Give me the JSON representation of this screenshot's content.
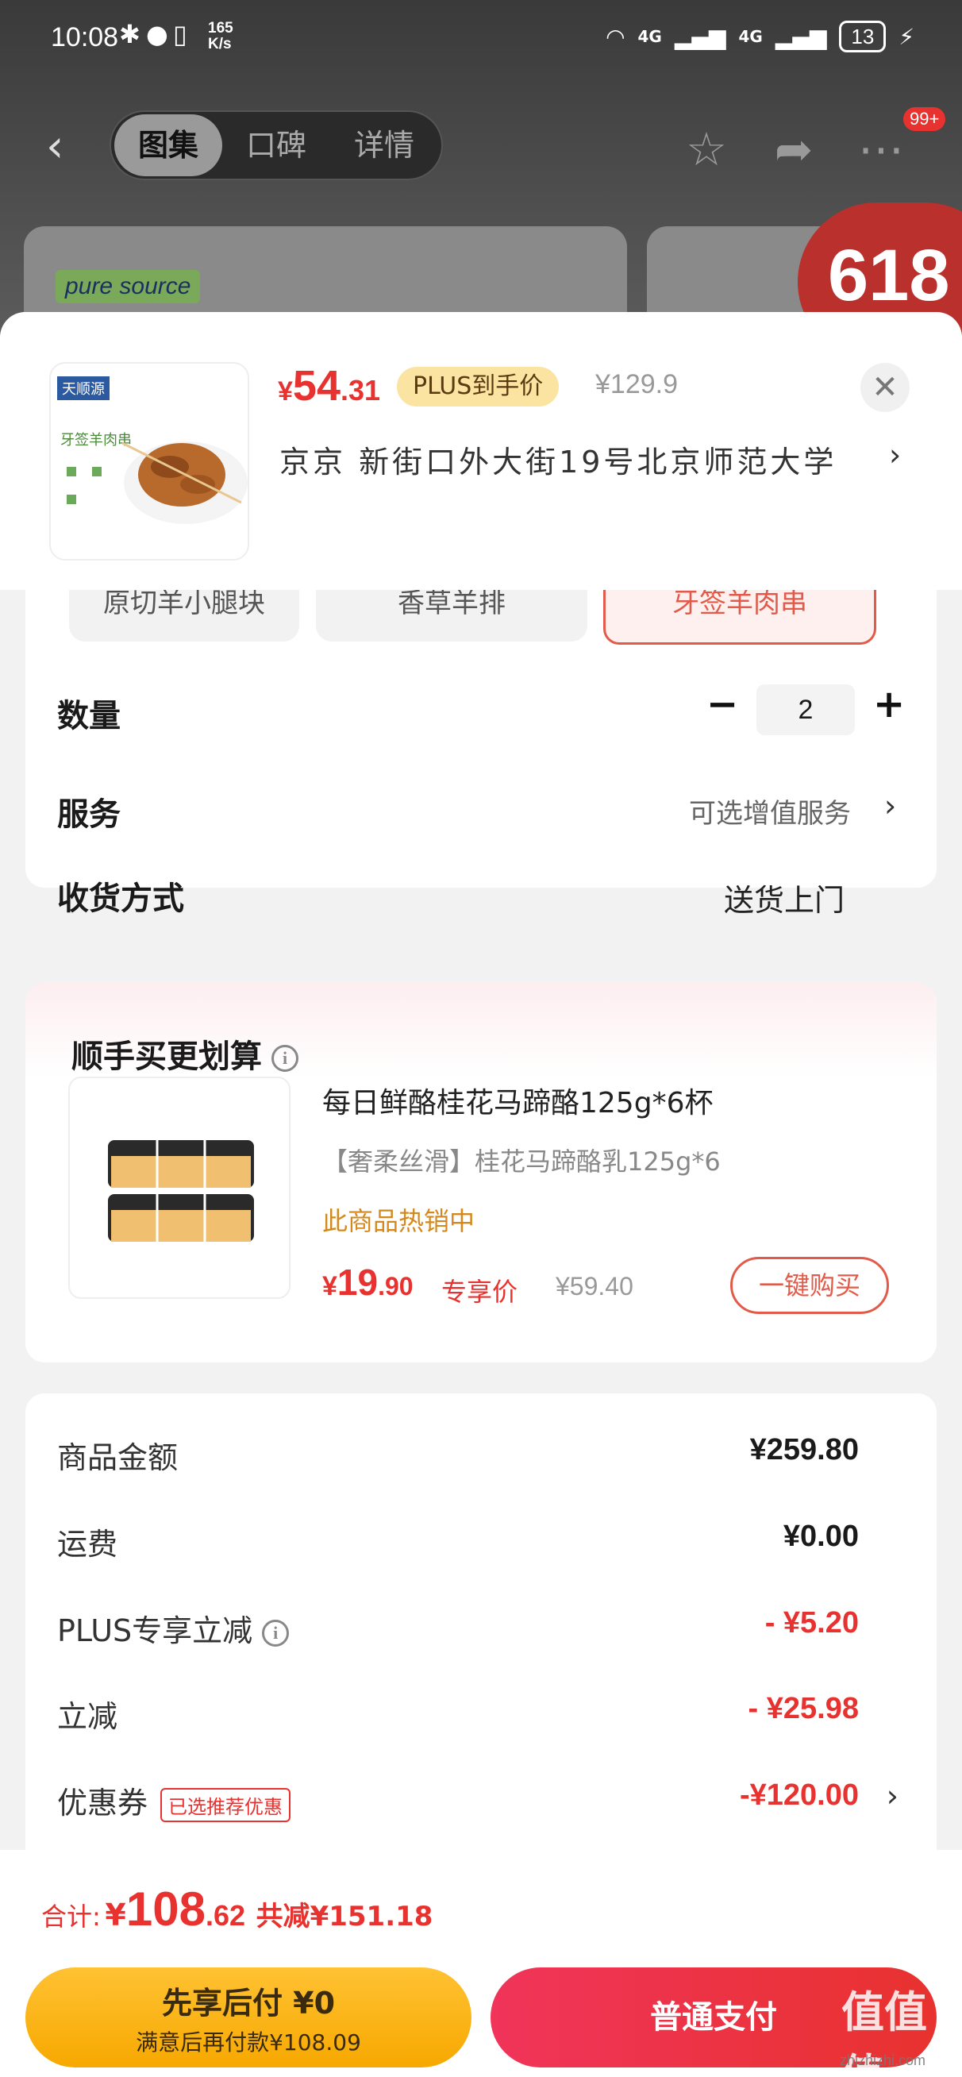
{
  "status_bar": {
    "time": "10:08",
    "net_speed_value": "165",
    "net_speed_unit": "K/s",
    "signal1": "4G",
    "signal2": "4G",
    "battery": "13"
  },
  "nav": {
    "tabs": [
      {
        "label": "图集",
        "active": true
      },
      {
        "label": "口碑",
        "active": false
      },
      {
        "label": "详情",
        "active": false
      }
    ],
    "badge": "99+",
    "brand_text": "pure source",
    "promo_text": "618"
  },
  "product": {
    "price_currency": "¥",
    "price_int": "54",
    "price_dec": ".31",
    "plus_tag": "PLUS到手价",
    "original_price": "¥129.9",
    "address": "京京   新街口外大街19号北京师范大学",
    "image_brand": "天顺源",
    "image_caption": "牙签羊肉串"
  },
  "specs": [
    {
      "label": "原切羊小腿块",
      "selected": false
    },
    {
      "label": "香草羊排",
      "selected": false
    },
    {
      "label": "牙签羊肉串",
      "selected": true
    }
  ],
  "options": {
    "quantity_label": "数量",
    "quantity_value": "2",
    "minus": "−",
    "plus": "+",
    "service_label": "服务",
    "service_value": "可选增值服务",
    "delivery_label": "收货方式",
    "delivery_value": "送货上门"
  },
  "upsell": {
    "title": "顺手买更划算",
    "name": "每日鲜酪桂花马蹄酪125g*6杯",
    "desc": "【奢柔丝滑】桂花马蹄酪乳125g*6",
    "hot": "此商品热销中",
    "price_currency": "¥",
    "price_int": "19",
    "price_dec": ".90",
    "exclusive": "专享价",
    "original": "¥59.40",
    "buy_label": "一键购买"
  },
  "summary": {
    "rows": [
      {
        "label": "商品金额",
        "value": "¥259.80"
      },
      {
        "label": "运费",
        "value": "¥0.00"
      },
      {
        "label": "PLUS专享立减",
        "value": "- ¥5.20"
      },
      {
        "label": "立减",
        "value": "- ¥25.98"
      },
      {
        "label": "优惠券",
        "value": "-¥120.00",
        "tag": "已选推荐优惠"
      }
    ]
  },
  "footer": {
    "total_label": "合计:",
    "total_currency": "¥",
    "total_int": "108",
    "total_dec": ".62",
    "saved": "共减¥151.18",
    "later_line1": "先享后付 ¥0",
    "later_line2": "满意后再付款¥108.09",
    "pay_label": "普通支付"
  },
  "watermark": {
    "text": "值值值",
    "sub": "zhizhizhi.com"
  },
  "colors": {
    "accent_red": "#e8322f",
    "gold": "#f7a800",
    "hot_orange": "#d4891f"
  }
}
